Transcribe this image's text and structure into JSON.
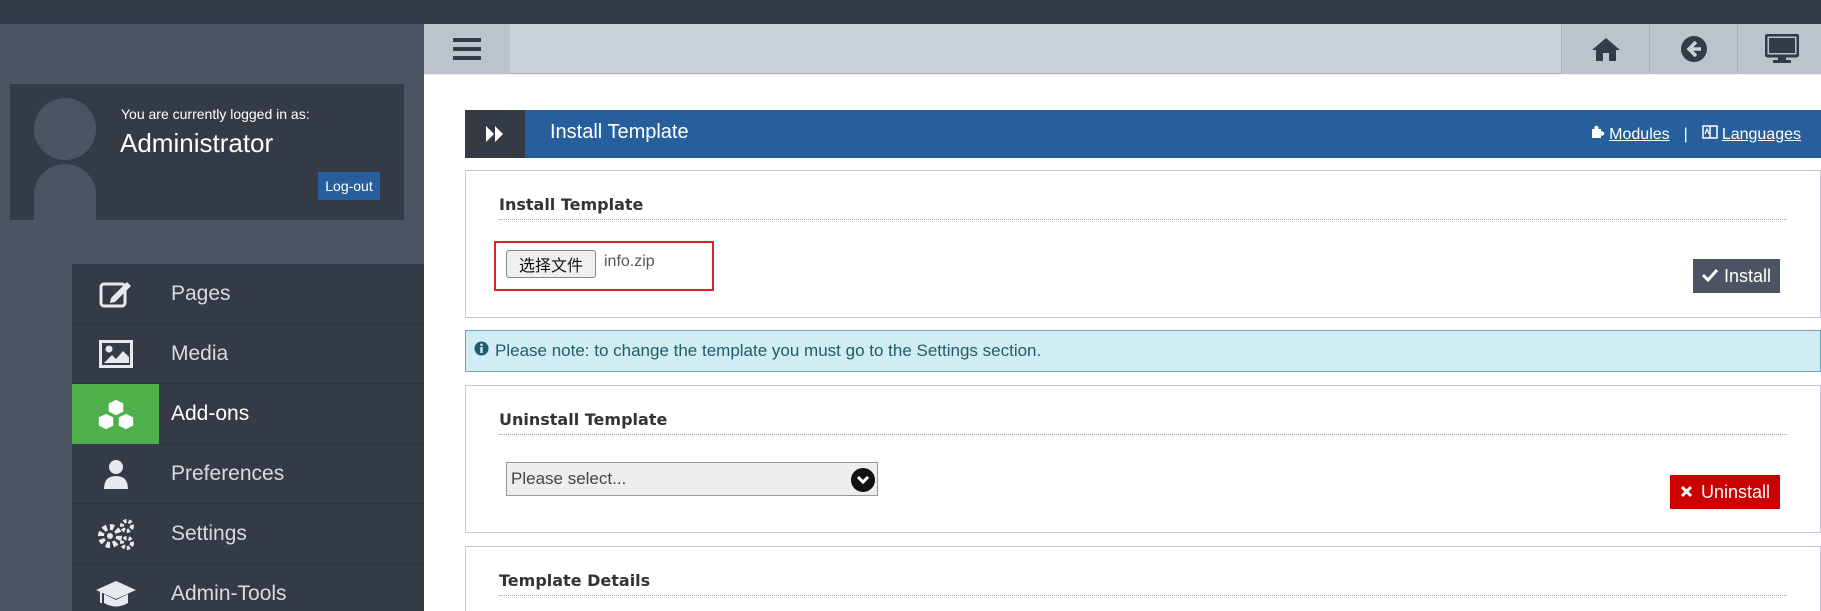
{
  "user": {
    "logged_in_label": "You are currently logged in as:",
    "name": "Administrator",
    "logout_label": "Log-out"
  },
  "menu": {
    "items": [
      {
        "label": "Pages",
        "icon": "edit-icon"
      },
      {
        "label": "Media",
        "icon": "image-icon"
      },
      {
        "label": "Add-ons",
        "icon": "cubes-icon",
        "active": true
      },
      {
        "label": "Preferences",
        "icon": "user-icon"
      },
      {
        "label": "Settings",
        "icon": "gears-icon"
      },
      {
        "label": "Admin-Tools",
        "icon": "graduation-cap-icon"
      }
    ]
  },
  "toolbar": {
    "icons": [
      "menu-icon",
      "home-icon",
      "back-icon",
      "desktop-icon"
    ]
  },
  "header": {
    "title": "Install Template",
    "links": {
      "modules": "Modules",
      "separator": "|",
      "languages": "Languages"
    }
  },
  "install_panel": {
    "title": "Install Template",
    "file_button": "选择文件",
    "file_name": "info.zip",
    "install_button": "Install"
  },
  "note": {
    "text": "Please note: to change the template you must go to the Settings section."
  },
  "uninstall_panel": {
    "title": "Uninstall Template",
    "select_value": "Please select...",
    "uninstall_button": "Uninstall"
  },
  "details_panel": {
    "title": "Template Details"
  },
  "colors": {
    "accent_blue": "#265f9b",
    "active_green": "#4db04a",
    "danger_red": "#cc0000",
    "sidebar_dark": "#343a46"
  }
}
